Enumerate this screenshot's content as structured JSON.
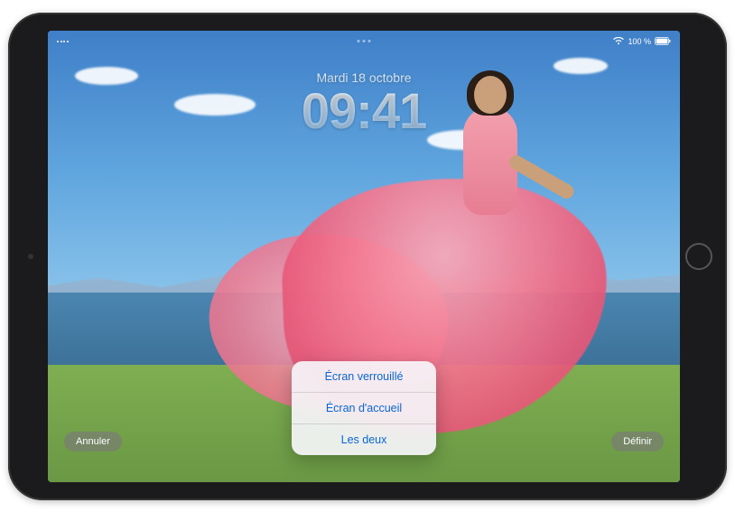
{
  "status_bar": {
    "battery_text": "100 %"
  },
  "datetime": {
    "date": "Mardi 18 octobre",
    "time": "09:41"
  },
  "popup": {
    "items": [
      {
        "label": "Écran verrouillé"
      },
      {
        "label": "Écran d'accueil"
      },
      {
        "label": "Les deux"
      }
    ]
  },
  "buttons": {
    "cancel": "Annuler",
    "set": "Définir"
  }
}
